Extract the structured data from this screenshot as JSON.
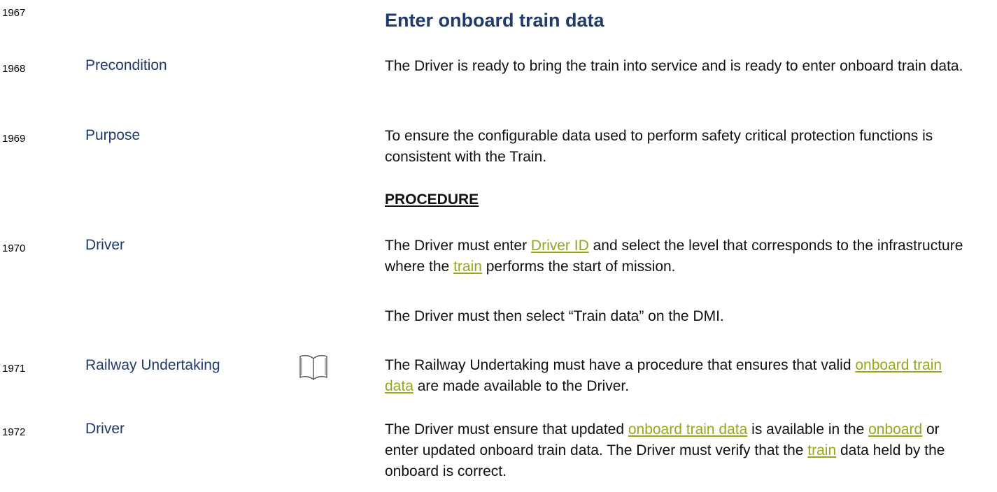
{
  "header": {
    "line_number": "1967",
    "title": "Enter onboard train data"
  },
  "rows": [
    {
      "line": "1968",
      "role": "Precondition",
      "text": "The Driver is ready to bring the train into service and is ready to enter onboard train data."
    },
    {
      "line": "1969",
      "role": "Purpose",
      "text": "To ensure the configurable data used to perform safety critical protection functions is consistent with the Train."
    },
    {
      "subheading": "PROCEDURE"
    },
    {
      "line": "1970",
      "role": "Driver",
      "t1": "The Driver must enter ",
      "link1": "Driver ID",
      "t2": " and select the level that corresponds to the infrastructure where the ",
      "link2": "train",
      "t3": " performs the start of mission.",
      "p2": "The Driver must then select “Train data” on the DMI."
    },
    {
      "line": "1971",
      "role": "Railway Undertaking",
      "icon": "book-icon",
      "t1": "The Railway Undertaking must have a procedure that ensures that valid ",
      "link1": "onboard train data",
      "t2": " are made available to the Driver."
    },
    {
      "line": "1972",
      "role": "Driver",
      "t1": "The Driver must ensure that updated ",
      "link1": "onboard train data",
      "t2": " is available in the ",
      "link2": "onboard",
      "t3": " or enter updated onboard train data. The Driver must verify that the ",
      "link3": "train",
      "t4": " data held by the onboard is correct."
    }
  ],
  "colors": {
    "heading": "#1f3a6e",
    "link": "#93a81d"
  }
}
